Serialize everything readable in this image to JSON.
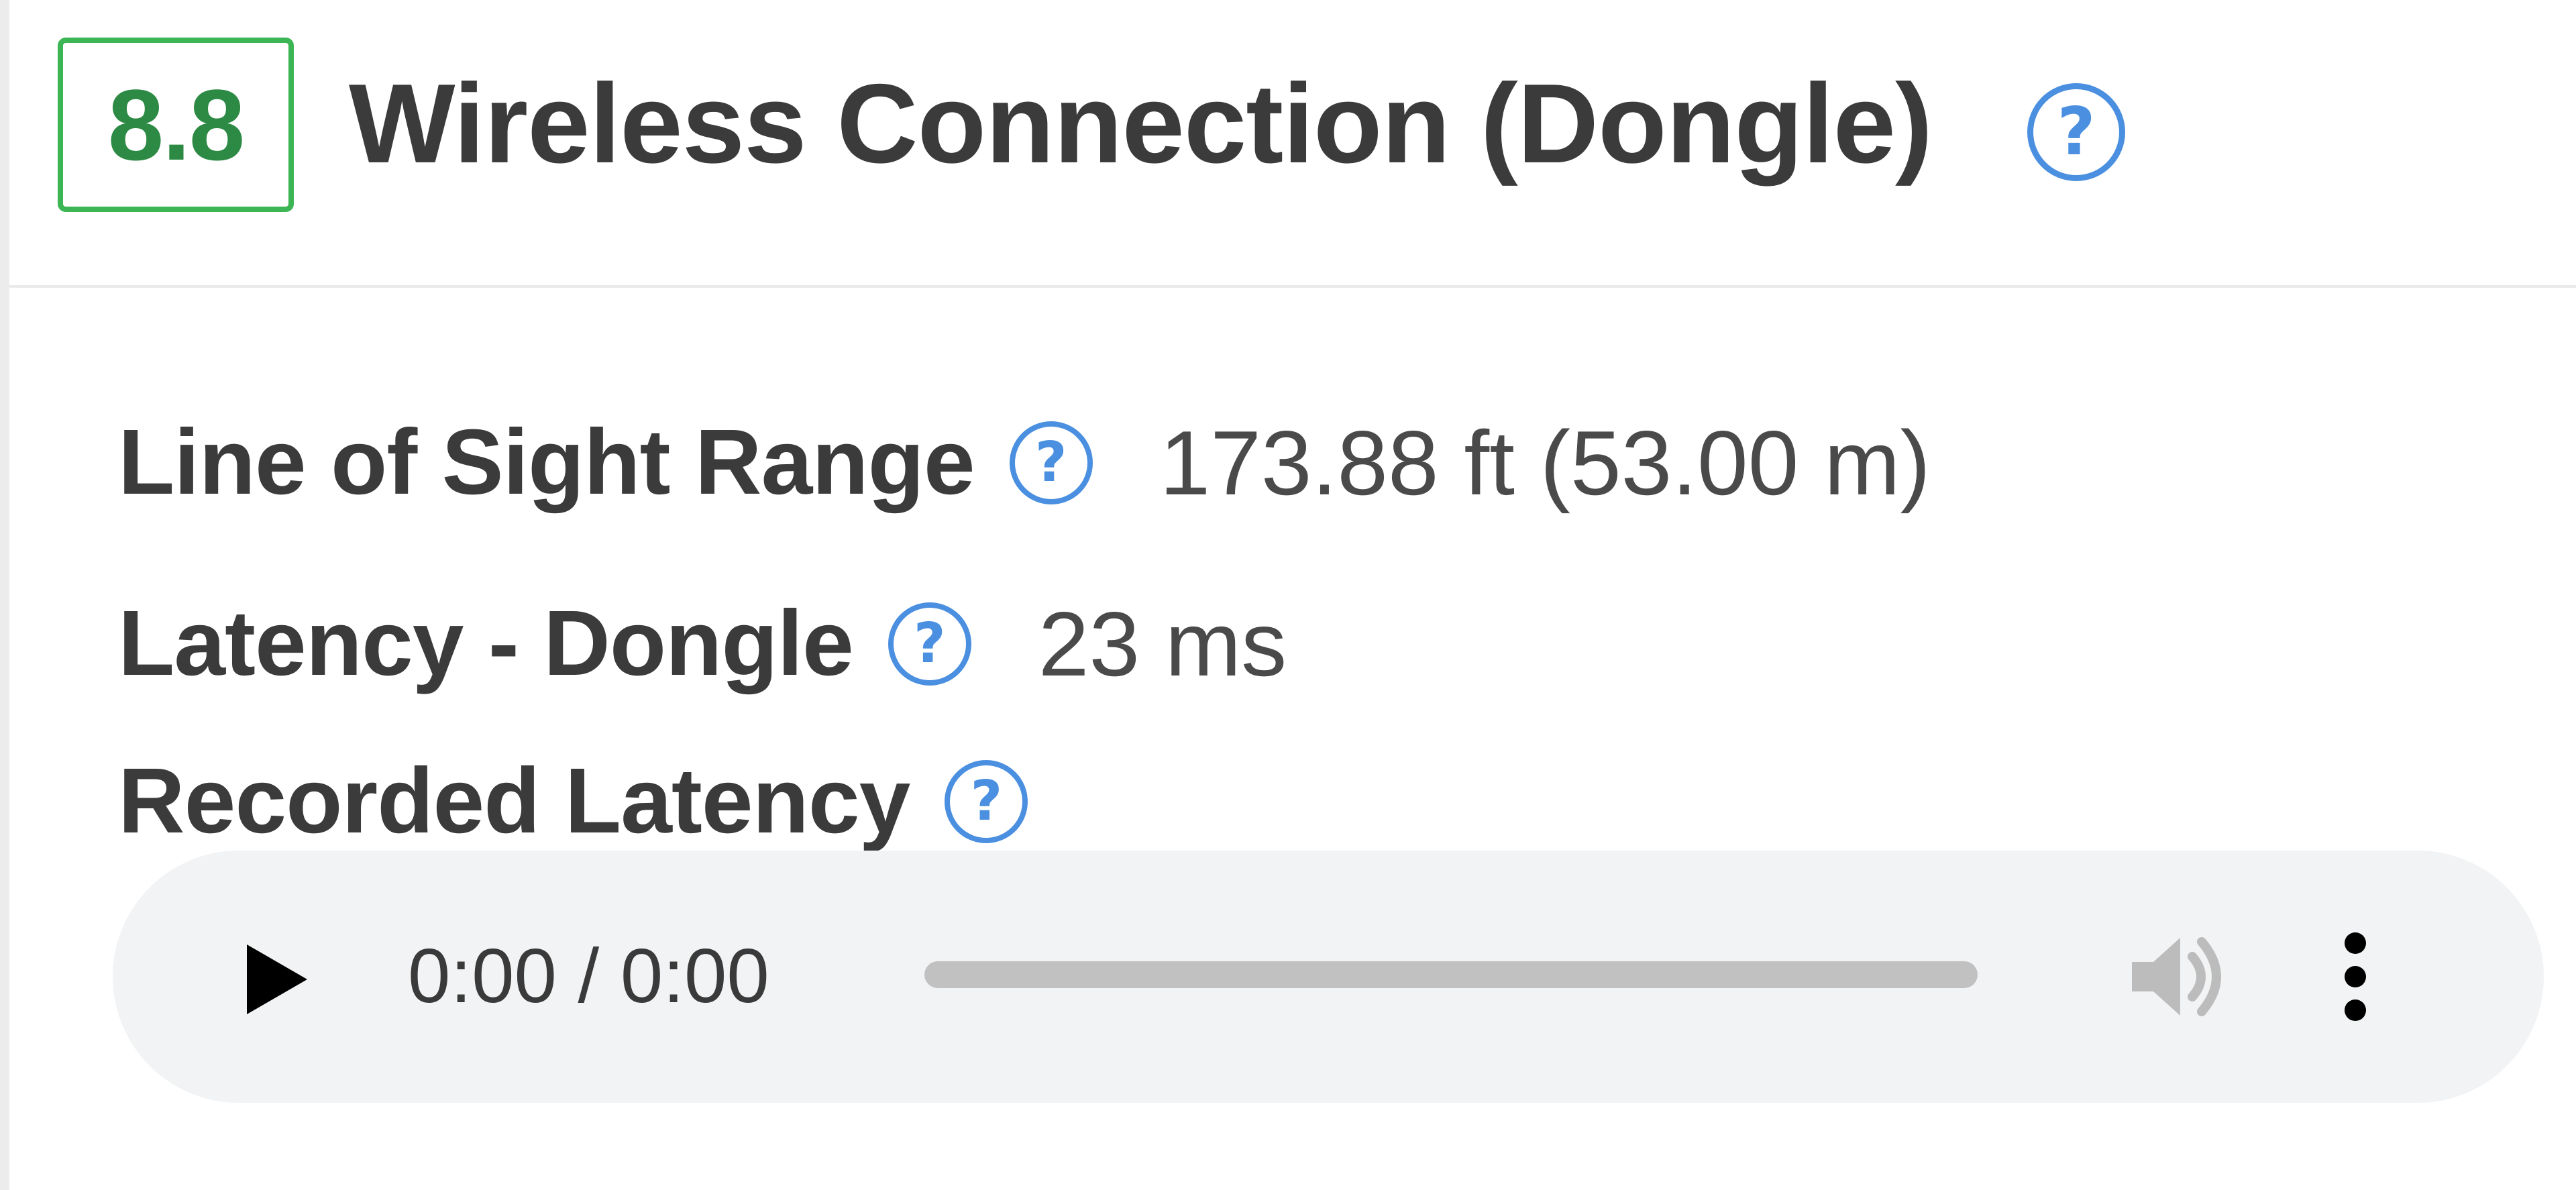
{
  "header": {
    "score": "8.8",
    "title": "Wireless Connection (Dongle)",
    "help_symbol": "?"
  },
  "specs": [
    {
      "label": "Line of Sight Range",
      "value": "173.88 ft (53.00 m)",
      "help_symbol": "?"
    },
    {
      "label": "Latency - Dongle",
      "value": "23 ms",
      "help_symbol": "?"
    },
    {
      "label": "Recorded Latency",
      "value": "",
      "help_symbol": "?"
    }
  ],
  "audio_player": {
    "time": "0:00 / 0:00",
    "progress": 0,
    "icons": {
      "play": "play-icon",
      "volume": "volume-icon",
      "more": "more-options-icon"
    }
  },
  "colors": {
    "score_border": "#3cb554",
    "score_text": "#2d8a44",
    "help_blue": "#4a8fe0",
    "player_bg": "#f1f3f4"
  }
}
